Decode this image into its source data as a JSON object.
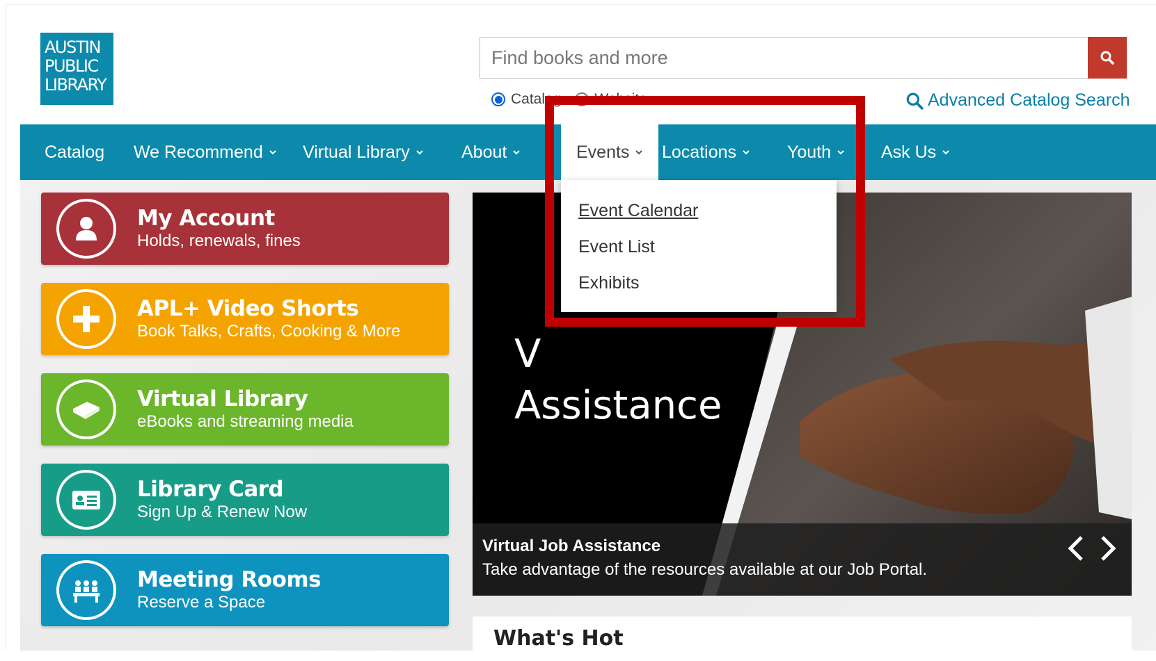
{
  "logo": {
    "lines": [
      "AUSTIN",
      "PUBLIC",
      "LIBRARY"
    ]
  },
  "search": {
    "placeholder": "Find books and more",
    "scope_catalog": "Catalog",
    "scope_website": "Website",
    "advanced_label": "Advanced Catalog Search"
  },
  "nav": {
    "items": [
      {
        "label": "Catalog"
      },
      {
        "label": "We Recommend"
      },
      {
        "label": "Virtual Library"
      },
      {
        "label": "About"
      },
      {
        "label": "Events"
      },
      {
        "label": "Locations"
      },
      {
        "label": "Youth"
      },
      {
        "label": "Ask Us"
      }
    ]
  },
  "events_menu": {
    "items": [
      "Event Calendar",
      "Event List",
      "Exhibits"
    ]
  },
  "tiles": [
    {
      "title": "My Account",
      "subtitle": "Holds, renewals, fines",
      "color": "#a83239",
      "icon": "user-icon"
    },
    {
      "title": "APL+ Video Shorts",
      "subtitle": "Book Talks, Crafts, Cooking & More",
      "color": "#f4a300",
      "icon": "plus-icon"
    },
    {
      "title": "Virtual Library",
      "subtitle": "eBooks and streaming media",
      "color": "#6bb62a",
      "icon": "book-icon"
    },
    {
      "title": "Library Card",
      "subtitle": "Sign Up & Renew Now",
      "color": "#179c87",
      "icon": "id-card-icon"
    },
    {
      "title": "Meeting Rooms",
      "subtitle": "Reserve a Space",
      "color": "#0d93be",
      "icon": "meeting-icon"
    }
  ],
  "carousel": {
    "slide_text_line1": "V",
    "slide_text_line2": "Assistance",
    "caption_title": "Virtual Job Assistance",
    "caption_text": "Take advantage of the resources available at our Job Portal."
  },
  "whats_hot": {
    "title": "What's Hot"
  },
  "colors": {
    "brand": "#0d8aab",
    "search_button": "#c0392b",
    "highlight": "#c00000"
  }
}
